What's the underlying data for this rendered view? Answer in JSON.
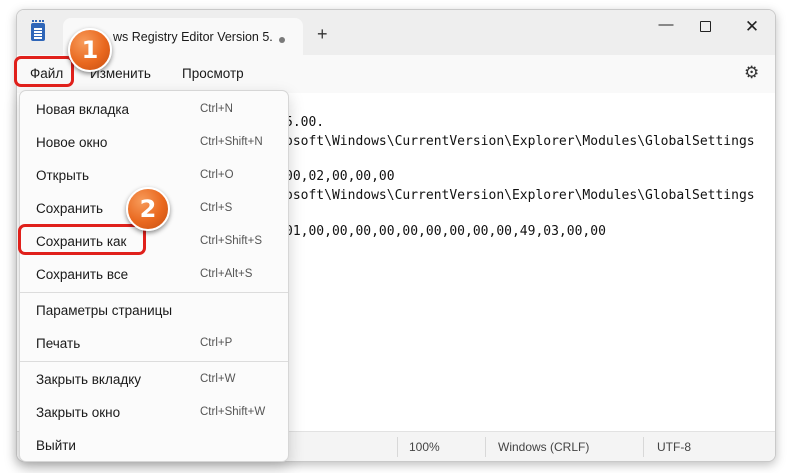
{
  "window": {
    "tab_title": "ws Registry Editor Version 5.",
    "new_tab_icon": "+",
    "minimize_icon": "—",
    "close_icon": "✕"
  },
  "menubar": {
    "file": "Файл",
    "edit": "Изменить",
    "view": "Просмотр",
    "settings_icon": "⚙"
  },
  "editor": {
    "lines": [
      "5.00.",
      "osoft\\Windows\\CurrentVersion\\Explorer\\Modules\\GlobalSettings",
      "00,02,00,00,00",
      "osoft\\Windows\\CurrentVersion\\Explorer\\Modules\\GlobalSettings",
      "01,00,00,00,00,00,00,00,00,00,49,03,00,00"
    ]
  },
  "status": {
    "zoom": "100%",
    "line_ending": "Windows (CRLF)",
    "encoding": "UTF-8"
  },
  "file_menu": {
    "items": [
      {
        "label": "Новая вкладка",
        "shortcut": "Ctrl+N"
      },
      {
        "label": "Новое окно",
        "shortcut": "Ctrl+Shift+N"
      },
      {
        "label": "Открыть",
        "shortcut": "Ctrl+O"
      },
      {
        "label": "Сохранить",
        "shortcut": "Ctrl+S"
      },
      {
        "label": "Сохранить как",
        "shortcut": "Ctrl+Shift+S"
      },
      {
        "label": "Сохранить все",
        "shortcut": "Ctrl+Alt+S"
      },
      {
        "label": "Параметры страницы",
        "shortcut": ""
      },
      {
        "label": "Печать",
        "shortcut": "Ctrl+P"
      },
      {
        "label": "Закрыть вкладку",
        "shortcut": "Ctrl+W"
      },
      {
        "label": "Закрыть окно",
        "shortcut": "Ctrl+Shift+W"
      },
      {
        "label": "Выйти",
        "shortcut": ""
      }
    ]
  },
  "annotations": {
    "step1": "1",
    "step2": "2",
    "highlight_color": "#e0201b",
    "badge_color": "#e9681f"
  }
}
